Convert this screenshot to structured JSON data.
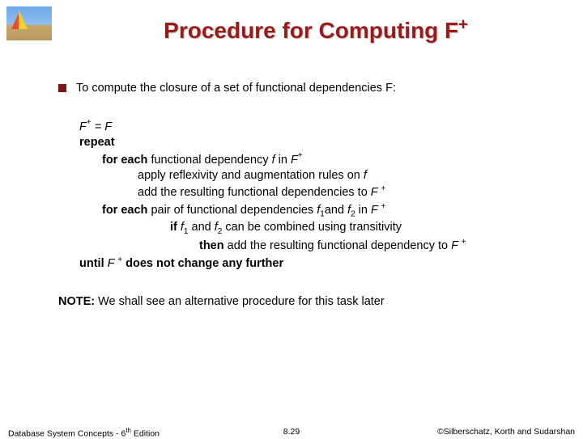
{
  "title": {
    "main": "Procedure for Computing F",
    "sup": "+"
  },
  "bullet_text": "To compute the closure of a set of functional dependencies F:",
  "algo": {
    "l1a": "F",
    "l1b": "+",
    "l1c": " = F",
    "l2": "repeat",
    "l3a": "for each",
    "l3b": " functional dependency ",
    "l3c": "f",
    "l3d": " in ",
    "l3e": "F",
    "l3f": "+",
    "l4a": "apply reflexivity and augmentation rules on ",
    "l4b": "f",
    "l5a": "add the resulting functional dependencies to ",
    "l5b": "F ",
    "l5c": "+",
    "l6a": "for each",
    "l6b": " pair of functional dependencies ",
    "l6c": "f",
    "l6d": "1",
    "l6e": "and ",
    "l6f": "f",
    "l6g": "2",
    "l6h": " in ",
    "l6i": "F ",
    "l6j": "+",
    "l7a": "if ",
    "l7b": "f",
    "l7c": "1",
    "l7d": " and ",
    "l7e": "f",
    "l7f": "2",
    "l7g": " can be combined using transitivity",
    "l8a": "then",
    "l8b": " add the resulting functional dependency to ",
    "l8c": "F ",
    "l8d": "+",
    "l9a": "until ",
    "l9b": "F ",
    "l9c": "+",
    "l9d": " does not change any further"
  },
  "note": {
    "label": "NOTE:",
    "rest": "  We shall see an alternative procedure for this task later"
  },
  "footer": {
    "left_a": "Database System Concepts - 6",
    "left_th": "th",
    "left_b": " Edition",
    "center": "8.29",
    "right": "©Silberschatz, Korth and Sudarshan"
  }
}
